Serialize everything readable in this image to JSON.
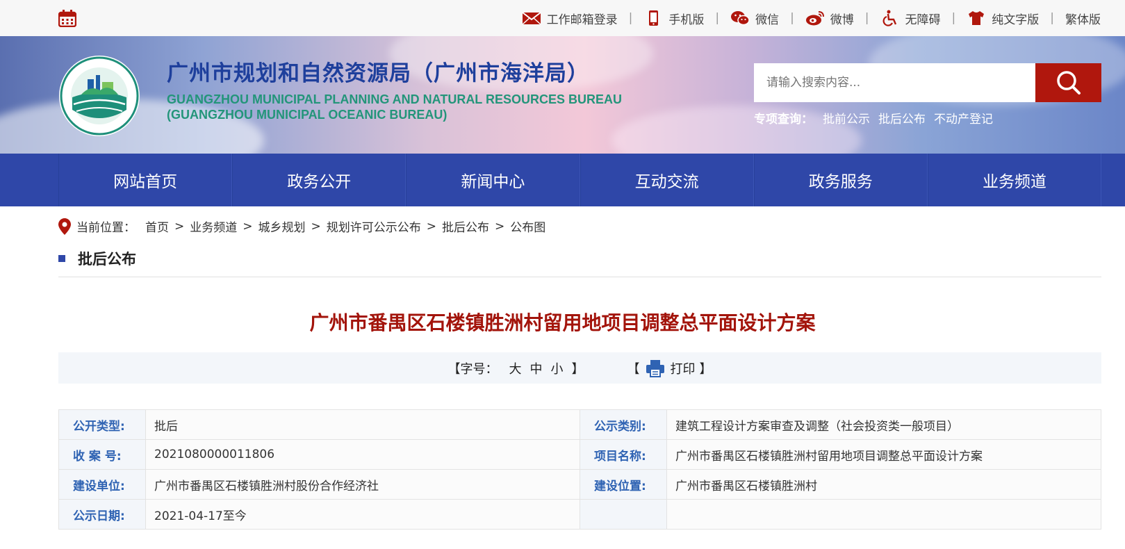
{
  "topbar": {
    "links": [
      {
        "label": "工作邮箱登录",
        "icon": "mail-icon"
      },
      {
        "label": "手机版",
        "icon": "mobile-icon"
      },
      {
        "label": "微信",
        "icon": "wechat-icon"
      },
      {
        "label": "微博",
        "icon": "weibo-icon"
      },
      {
        "label": "无障碍",
        "icon": "accessibility-icon"
      },
      {
        "label": "纯文字版",
        "icon": "shirt-icon"
      },
      {
        "label": "繁体版",
        "icon": ""
      }
    ],
    "separator": "|"
  },
  "header": {
    "title": "广州市规划和自然资源局（广州市海洋局）",
    "subtitle_en_line1": "GUANGZHOU MUNICIPAL PLANNING AND NATURAL RESOURCES BUREAU",
    "subtitle_en_line2": "(GUANGZHOU MUNICIPAL OCEANIC BUREAU)",
    "search_placeholder": "请输入搜索内容...",
    "special_label": "专项查询：",
    "special_links": [
      "批前公示",
      "批后公布",
      "不动产登记"
    ]
  },
  "nav": {
    "items": [
      "网站首页",
      "政务公开",
      "新闻中心",
      "互动交流",
      "政务服务",
      "业务频道"
    ]
  },
  "breadcrumb": {
    "label": "当前位置：",
    "items": [
      "首页",
      "业务频道",
      "城乡规划",
      "规划许可公示公布",
      "批后公布",
      "公布图"
    ],
    "separator": ">"
  },
  "section": {
    "title": "批后公布"
  },
  "document": {
    "title": "广州市番禺区石楼镇胜洲村留用地项目调整总平面设计方案",
    "font_size_label": "【字号：",
    "font_sizes": [
      "大",
      "中",
      "小"
    ],
    "font_size_end": "】",
    "print_open": "【",
    "print_label": "打印",
    "print_close": "】"
  },
  "info": [
    {
      "k1": "公开类型:",
      "v1": "批后",
      "k2": "公示类别:",
      "v2": "建筑工程设计方案审查及调整（社会投资类一般项目）"
    },
    {
      "k1": "收 案 号:",
      "v1": "2021080000011806",
      "k2": "项目名称:",
      "v2": "广州市番禺区石楼镇胜洲村留用地项目调整总平面设计方案"
    },
    {
      "k1": "建设单位:",
      "v1": "广州市番禺区石楼镇胜洲村股份合作经济社",
      "k2": "建设位置:",
      "v2": "广州市番禺区石楼镇胜洲村"
    },
    {
      "k1": "公示日期:",
      "v1": "2021-04-17至今",
      "k2": "",
      "v2": ""
    }
  ],
  "colors": {
    "accent_red": "#b0170d",
    "nav_blue": "#2f47a8",
    "label_blue": "#2f63b3",
    "title_red": "#a3140b"
  }
}
